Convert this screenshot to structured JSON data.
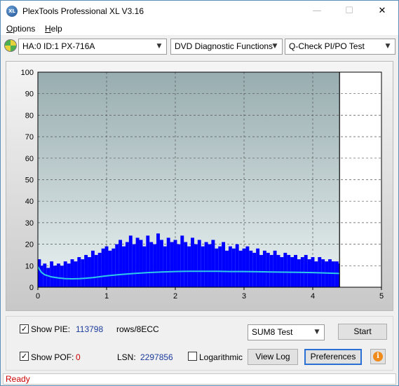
{
  "window": {
    "title": "PlexTools Professional XL V3.16",
    "app_icon_text": "XL",
    "controls": {
      "minimize": "—",
      "maximize": "☐",
      "close": "✕"
    }
  },
  "menu": [
    {
      "label": "Options",
      "mnemonic": "O",
      "rest": "ptions"
    },
    {
      "label": "Help",
      "mnemonic": "H",
      "rest": "elp"
    }
  ],
  "toolbar": {
    "drive": "HA:0 ID:1  PX-716A",
    "function": "DVD Diagnostic Functions",
    "test": "Q-Check PI/PO Test"
  },
  "chart_data": {
    "type": "bar",
    "title": "",
    "xlabel": "",
    "ylabel": "",
    "xlim": [
      0,
      5
    ],
    "ylim": [
      0,
      100
    ],
    "x_ticks": [
      "0",
      "1",
      "2",
      "3",
      "4",
      "5"
    ],
    "y_ticks": [
      "0",
      "10",
      "20",
      "30",
      "40",
      "50",
      "60",
      "70",
      "80",
      "90",
      "100"
    ],
    "grid": true,
    "end_marker_x": 4.39,
    "series": [
      {
        "type": "bar",
        "color": "#0000ff",
        "x": [
          0.02,
          0.05,
          0.1,
          0.15,
          0.2,
          0.25,
          0.3,
          0.35,
          0.4,
          0.45,
          0.5,
          0.55,
          0.6,
          0.65,
          0.7,
          0.75,
          0.8,
          0.85,
          0.9,
          0.95,
          1.0,
          1.05,
          1.1,
          1.15,
          1.2,
          1.25,
          1.3,
          1.35,
          1.4,
          1.45,
          1.5,
          1.55,
          1.6,
          1.65,
          1.7,
          1.75,
          1.8,
          1.85,
          1.9,
          1.95,
          2.0,
          2.05,
          2.1,
          2.15,
          2.2,
          2.25,
          2.3,
          2.35,
          2.4,
          2.45,
          2.5,
          2.55,
          2.6,
          2.65,
          2.7,
          2.75,
          2.8,
          2.85,
          2.9,
          2.95,
          3.0,
          3.05,
          3.1,
          3.15,
          3.2,
          3.25,
          3.3,
          3.35,
          3.4,
          3.45,
          3.5,
          3.55,
          3.6,
          3.65,
          3.7,
          3.75,
          3.8,
          3.85,
          3.9,
          3.95,
          4.0,
          4.05,
          4.1,
          4.15,
          4.2,
          4.25,
          4.3,
          4.35,
          4.38
        ],
        "values": [
          13,
          10,
          11,
          9,
          12,
          10,
          11,
          10,
          12,
          11,
          13,
          12,
          14,
          13,
          15,
          14,
          17,
          15,
          16,
          18,
          19,
          17,
          18,
          20,
          22,
          19,
          21,
          24,
          20,
          23,
          22,
          19,
          24,
          21,
          20,
          25,
          22,
          19,
          23,
          21,
          22,
          20,
          24,
          21,
          19,
          23,
          20,
          22,
          19,
          21,
          20,
          22,
          18,
          19,
          21,
          17,
          19,
          18,
          20,
          17,
          18,
          19,
          17,
          16,
          18,
          15,
          17,
          16,
          15,
          17,
          15,
          14,
          16,
          15,
          14,
          15,
          13,
          14,
          15,
          13,
          14,
          12,
          14,
          13,
          12,
          13,
          12,
          12,
          11
        ]
      },
      {
        "type": "line",
        "color": "#2ec8e8",
        "x": [
          0.0,
          0.05,
          0.1,
          0.2,
          0.3,
          0.4,
          0.5,
          0.6,
          0.7,
          0.8,
          0.9,
          1.0,
          1.2,
          1.4,
          1.6,
          1.8,
          2.0,
          2.2,
          2.4,
          2.6,
          2.8,
          3.0,
          3.2,
          3.4,
          3.6,
          3.8,
          4.0,
          4.2,
          4.39
        ],
        "values": [
          9.5,
          7.0,
          5.8,
          4.8,
          4.3,
          4.0,
          3.9,
          4.0,
          4.2,
          4.5,
          4.9,
          5.3,
          5.9,
          6.4,
          6.8,
          7.1,
          7.3,
          7.4,
          7.4,
          7.4,
          7.3,
          7.3,
          7.2,
          7.1,
          7.0,
          6.9,
          6.8,
          6.6,
          6.4
        ]
      }
    ]
  },
  "bottom_panel": {
    "show_pie_label": "Show PIE:",
    "show_pie_checked": "✓",
    "pie_value": "113798",
    "rows_label": "rows/8ECC",
    "show_pof_label": "Show POF:",
    "show_pof_checked": "✓",
    "pof_value": "0",
    "lsn_label": "LSN:",
    "lsn_value": "2297856",
    "logarithmic_label": "Logarithmic",
    "test_select": "SUM8 Test",
    "start_button": "Start",
    "view_log_button": "View Log",
    "preferences_button": "Preferences",
    "info_icon": "i"
  },
  "status": {
    "text": "Ready"
  }
}
